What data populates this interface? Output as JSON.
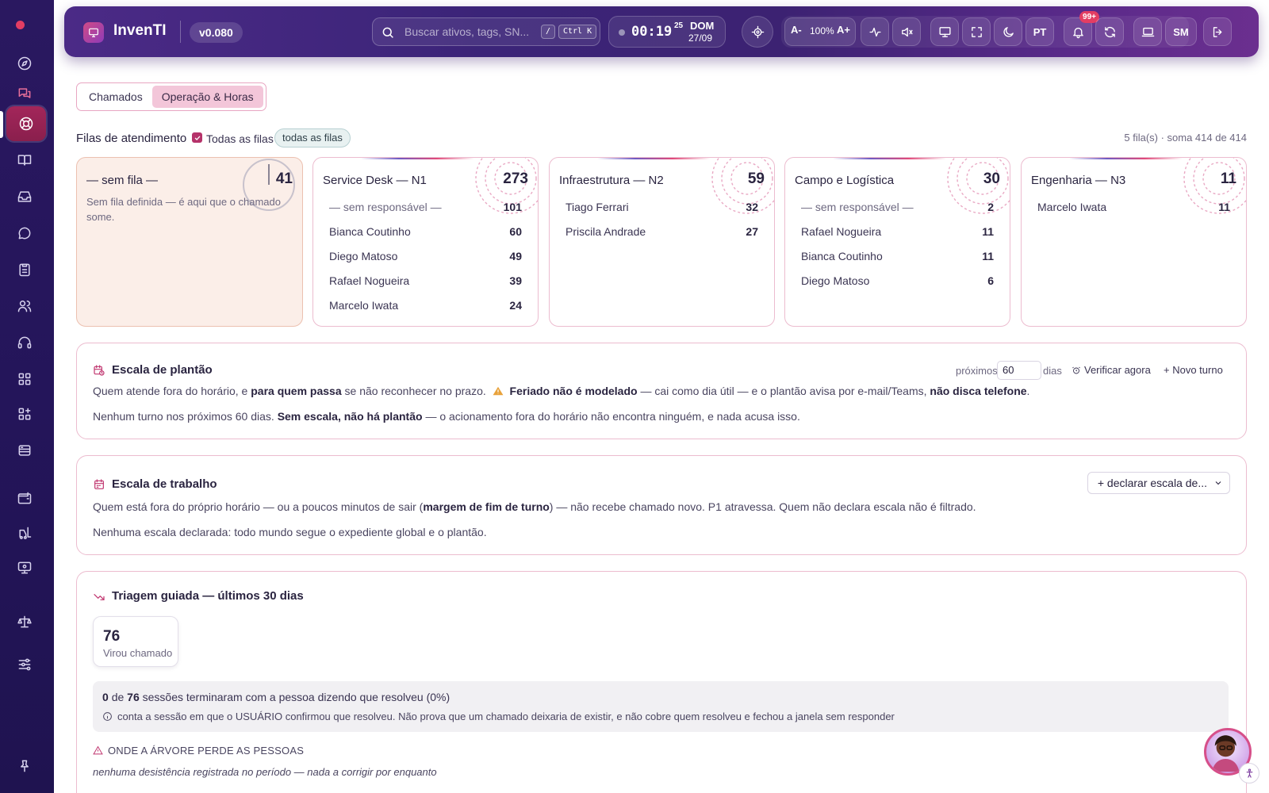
{
  "app": {
    "name": "InvenTI",
    "version": "v0.080"
  },
  "topbar": {
    "search_placeholder": "Buscar ativos, tags, SN...",
    "shortcut_slash": "/",
    "shortcut_ctrl": "Ctrl K",
    "clock_time": "00:19",
    "clock_seconds": "25",
    "clock_day": "DOM",
    "clock_date": "27/09",
    "zoom_decrease": "A-",
    "zoom_level": "100%",
    "zoom_increase": "A+",
    "language": "PT",
    "notifications_badge": "99+",
    "user_initials": "SM"
  },
  "tabs": [
    {
      "label": "Chamados",
      "active": false
    },
    {
      "label": "Operação & Horas",
      "active": true
    }
  ],
  "queues": {
    "title": "Filas de atendimento",
    "all_checkbox_label": "Todas as filas",
    "all_checked": true,
    "filter_pill": "todas as filas",
    "summary": "5 fila(s) · soma 414 de 414",
    "cards": [
      {
        "name": "— sem fila —",
        "total": "41",
        "description": "Sem fila definida — é aqui que o chamado some.",
        "rows": []
      },
      {
        "name": "Service Desk — N1",
        "total": "273",
        "rows": [
          {
            "name": "— sem responsável —",
            "value": "101",
            "muted": true
          },
          {
            "name": "Bianca Coutinho",
            "value": "60"
          },
          {
            "name": "Diego Matoso",
            "value": "49"
          },
          {
            "name": "Rafael Nogueira",
            "value": "39"
          },
          {
            "name": "Marcelo Iwata",
            "value": "24"
          }
        ]
      },
      {
        "name": "Infraestrutura — N2",
        "total": "59",
        "rows": [
          {
            "name": "Tiago Ferrari",
            "value": "32"
          },
          {
            "name": "Priscila Andrade",
            "value": "27"
          }
        ]
      },
      {
        "name": "Campo e Logística",
        "total": "30",
        "rows": [
          {
            "name": "— sem responsável —",
            "value": "2",
            "muted": true
          },
          {
            "name": "Rafael Nogueira",
            "value": "11"
          },
          {
            "name": "Bianca Coutinho",
            "value": "11"
          },
          {
            "name": "Diego Matoso",
            "value": "6"
          }
        ]
      },
      {
        "name": "Engenharia — N3",
        "total": "11",
        "rows": [
          {
            "name": "Marcelo Iwata",
            "value": "11"
          }
        ]
      }
    ]
  },
  "oncall": {
    "title": "Escala de plantão",
    "next_label": "próximos",
    "days_value": "60",
    "days_label": "dias",
    "check_now": "Verificar agora",
    "new_shift": "+ Novo turno",
    "desc_1": "Quem atende fora do horário, e",
    "desc_2": "para quem passa",
    "desc_3": "se não reconhecer no prazo.",
    "desc_4": "Feriado não é modelado",
    "desc_5": "— cai como dia útil — e o plantão avisa por e-mail/Teams,",
    "desc_6": "não disca telefone",
    "desc_7": ".",
    "empty_1": "Nenhum turno nos próximos 60 dias.",
    "empty_2": "Sem escala, não há plantão",
    "empty_3": "— o acionamento fora do horário não encontra ninguém, e nada acusa isso."
  },
  "workscale": {
    "title": "Escala de trabalho",
    "declare_select": "+ declarar escala de...",
    "desc_1": "Quem está fora do próprio horário — ou a poucos minutos de sair (",
    "desc_2": "margem de fim de turno",
    "desc_3": ") — não recebe chamado novo. P1 atravessa. Quem não declara escala não é filtrado.",
    "empty": "Nenhuma escala declarada: todo mundo segue o expediente global e o plantão."
  },
  "triage": {
    "title": "Triagem guiada — últimos 30 dias",
    "stat_value": "76",
    "stat_label": "Virou chamado",
    "resolved_count": "0",
    "resolved_of": "de",
    "sessions_total": "76",
    "resolved_text": "sessões terminaram com a pessoa dizendo que resolveu (0%)",
    "resolved_note": "conta a sessão em que o USUÁRIO confirmou que resolveu. Não prova que um chamado deixaria de existir, e não cobre quem resolveu e fechou a janela sem responder",
    "where_title": "ONDE A ÁRVORE PERDE AS PESSOAS",
    "where_note": "nenhuma desistência registrada no período — nada a corrigir por enquanto"
  },
  "colors": {
    "accent": "#b5336a",
    "sidebar": "#24155a",
    "topbar": "#3b2478",
    "danger": "#e33d63"
  }
}
